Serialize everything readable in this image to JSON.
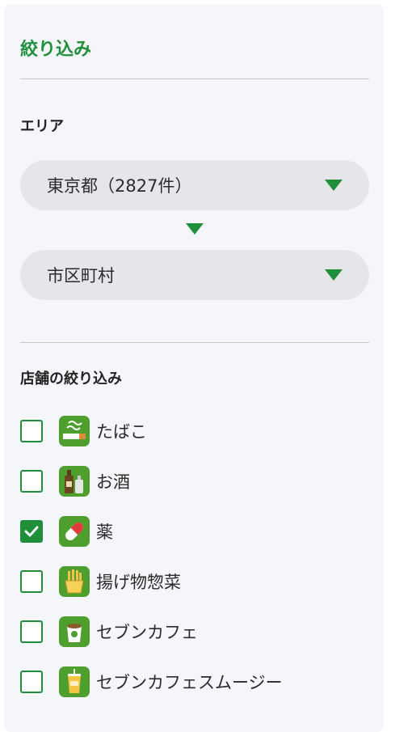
{
  "filter": {
    "title": "絞り込み",
    "area_label": "エリア",
    "prefecture_select": {
      "value": "東京都（2827件）"
    },
    "city_select": {
      "value": "市区町村"
    },
    "shop_filter_label": "店舗の絞り込み",
    "options": [
      {
        "label": "たばこ",
        "checked": false,
        "icon": "cigarette-icon"
      },
      {
        "label": "お酒",
        "checked": false,
        "icon": "liquor-bottles-icon"
      },
      {
        "label": "薬",
        "checked": true,
        "icon": "capsule-icon"
      },
      {
        "label": "揚げ物惣菜",
        "checked": false,
        "icon": "fried-food-icon"
      },
      {
        "label": "セブンカフェ",
        "checked": false,
        "icon": "coffee-cup-icon"
      },
      {
        "label": "セブンカフェスムージー",
        "checked": false,
        "icon": "smoothie-cup-icon"
      }
    ]
  },
  "colors": {
    "accent": "#1f8f3a",
    "panel_background": "#f5f6fa",
    "select_background": "#e5e5ea",
    "icon_background": "#4e9f2e"
  }
}
